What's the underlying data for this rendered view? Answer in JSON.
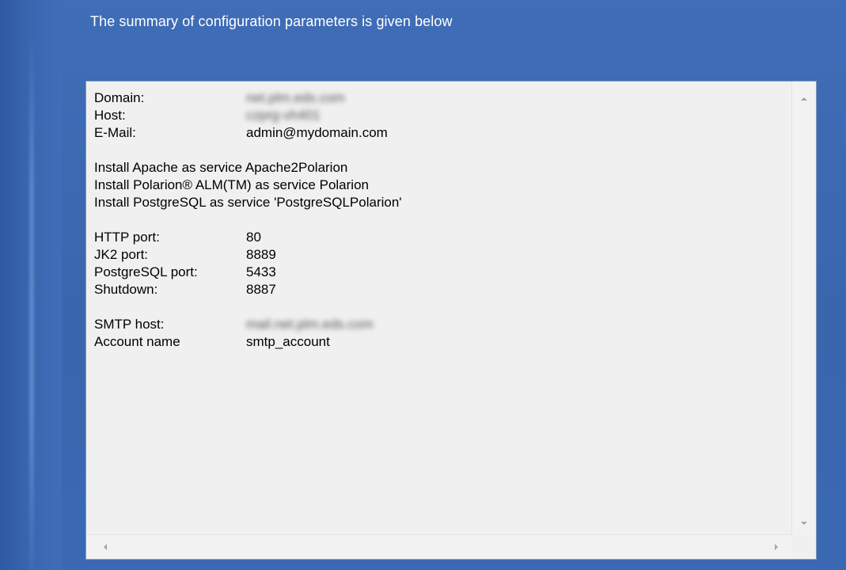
{
  "header": {
    "text": "The summary of configuration parameters is given below"
  },
  "summary": {
    "identity": [
      {
        "label": "Domain:",
        "value": "net.plm.eds.com",
        "blurred": true
      },
      {
        "label": "Host:",
        "value": "czprg-vh401",
        "blurred": true
      },
      {
        "label": "E-Mail:",
        "value": "admin@mydomain.com",
        "blurred": false
      }
    ],
    "services": [
      "Install Apache as service Apache2Polarion",
      "Install Polarion® ALM(TM) as service Polarion",
      "Install PostgreSQL as service 'PostgreSQLPolarion'"
    ],
    "ports": [
      {
        "label": "HTTP port:",
        "value": "80"
      },
      {
        "label": "JK2 port:",
        "value": "8889"
      },
      {
        "label": "PostgreSQL port:",
        "value": "5433"
      },
      {
        "label": "Shutdown:",
        "value": "8887"
      }
    ],
    "smtp": [
      {
        "label": "SMTP host:",
        "value": "mail.net.plm.eds.com",
        "blurred": true
      },
      {
        "label": "Account name",
        "value": "smtp_account",
        "blurred": false
      }
    ]
  },
  "icons": {
    "scroll_up": "arrow-up-icon",
    "scroll_down": "arrow-down-icon",
    "scroll_left": "arrow-left-icon",
    "scroll_right": "arrow-right-icon"
  },
  "colors": {
    "background": "#3a67b1",
    "panel": "#f0f0f0"
  }
}
